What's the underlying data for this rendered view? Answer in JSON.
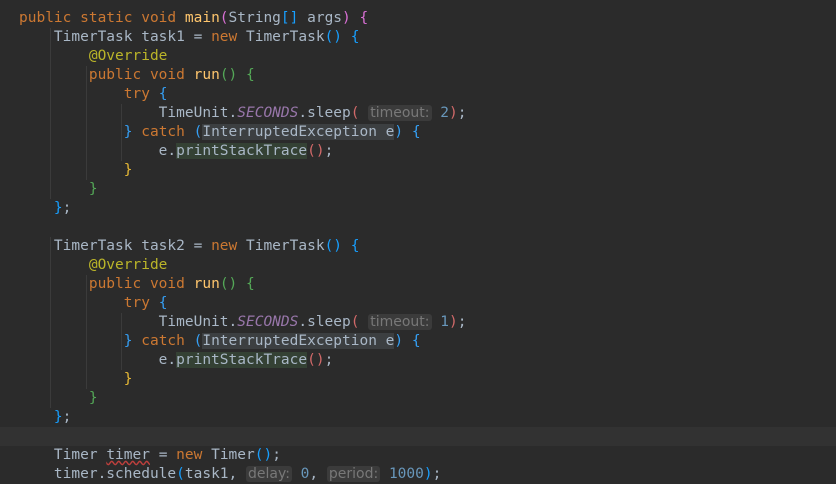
{
  "editor": {
    "language": "Java",
    "theme": "Darcula",
    "lines": [
      {
        "tokens": [
          [
            "kw",
            "public static void "
          ],
          [
            "fn",
            "main"
          ],
          [
            "p2",
            "("
          ],
          [
            "",
            "String"
          ],
          [
            "p3",
            "[]"
          ],
          [
            "",
            " args"
          ],
          [
            "p2",
            ")"
          ],
          [
            "",
            " "
          ],
          [
            "p2",
            "{"
          ]
        ]
      },
      {
        "tokens": [
          [
            "",
            "    TimerTask task1 = "
          ],
          [
            "kw",
            "new "
          ],
          [
            "",
            "TimerTask"
          ],
          [
            "p3",
            "()"
          ],
          [
            "",
            " "
          ],
          [
            "p3",
            "{"
          ]
        ]
      },
      {
        "tokens": [
          [
            "ann",
            "        @Override"
          ]
        ]
      },
      {
        "tokens": [
          [
            "kw",
            "        public void "
          ],
          [
            "fn",
            "run"
          ],
          [
            "p4",
            "()"
          ],
          [
            "",
            " "
          ],
          [
            "p4",
            "{"
          ]
        ]
      },
      {
        "tokens": [
          [
            "kw",
            "            try "
          ],
          [
            "p5",
            "{"
          ]
        ]
      },
      {
        "tokens": [
          [
            "",
            "                TimeUnit."
          ],
          [
            "static-field",
            "SECONDS"
          ],
          [
            "",
            ".sleep"
          ],
          [
            "p6",
            "("
          ],
          [
            "",
            " "
          ],
          [
            "hint",
            "timeout:"
          ],
          [
            "",
            " "
          ],
          [
            "num",
            "2"
          ],
          [
            "p6",
            ")"
          ],
          [
            "",
            ";"
          ]
        ]
      },
      {
        "tokens": [
          [
            "p5",
            "            }"
          ],
          [
            "kw",
            " catch "
          ],
          [
            "p5",
            "("
          ],
          [
            "hl",
            "InterruptedException e"
          ],
          [
            "p5",
            ")"
          ],
          [
            "",
            " "
          ],
          [
            "p5",
            "{"
          ]
        ]
      },
      {
        "tokens": [
          [
            "",
            "                e."
          ],
          [
            "hlw",
            "printStackTrace"
          ],
          [
            "p6",
            "()"
          ],
          [
            "",
            ";"
          ]
        ]
      },
      {
        "tokens": [
          [
            "p1",
            "            }"
          ]
        ]
      },
      {
        "tokens": [
          [
            "p4",
            "        }"
          ]
        ]
      },
      {
        "tokens": [
          [
            "p3",
            "    }"
          ],
          [
            "",
            ";"
          ]
        ]
      },
      {
        "tokens": []
      },
      {
        "tokens": [
          [
            "",
            "    TimerTask task2 = "
          ],
          [
            "kw",
            "new "
          ],
          [
            "",
            "TimerTask"
          ],
          [
            "p3",
            "()"
          ],
          [
            "",
            " "
          ],
          [
            "p3",
            "{"
          ]
        ]
      },
      {
        "tokens": [
          [
            "ann",
            "        @Override"
          ]
        ]
      },
      {
        "tokens": [
          [
            "kw",
            "        public void "
          ],
          [
            "fn",
            "run"
          ],
          [
            "p4",
            "()"
          ],
          [
            "",
            " "
          ],
          [
            "p4",
            "{"
          ]
        ]
      },
      {
        "tokens": [
          [
            "kw",
            "            try "
          ],
          [
            "p5",
            "{"
          ]
        ]
      },
      {
        "tokens": [
          [
            "",
            "                TimeUnit."
          ],
          [
            "static-field",
            "SECONDS"
          ],
          [
            "",
            ".sleep"
          ],
          [
            "p6",
            "("
          ],
          [
            "",
            " "
          ],
          [
            "hint",
            "timeout:"
          ],
          [
            "",
            " "
          ],
          [
            "num",
            "1"
          ],
          [
            "p6",
            ")"
          ],
          [
            "",
            ";"
          ]
        ]
      },
      {
        "tokens": [
          [
            "p5",
            "            }"
          ],
          [
            "kw",
            " catch "
          ],
          [
            "p5",
            "("
          ],
          [
            "hl",
            "InterruptedException e"
          ],
          [
            "p5",
            ")"
          ],
          [
            "",
            " "
          ],
          [
            "p5",
            "{"
          ]
        ]
      },
      {
        "tokens": [
          [
            "",
            "                e."
          ],
          [
            "hlw",
            "printStackTrace"
          ],
          [
            "p6",
            "()"
          ],
          [
            "",
            ";"
          ]
        ]
      },
      {
        "tokens": [
          [
            "p1",
            "            }"
          ]
        ]
      },
      {
        "tokens": [
          [
            "p4",
            "        }"
          ]
        ]
      },
      {
        "tokens": [
          [
            "p3",
            "    }"
          ],
          [
            "",
            ";"
          ]
        ]
      },
      {
        "tokens": [],
        "current": true
      },
      {
        "tokens": [
          [
            "",
            "    Timer "
          ],
          [
            "squiggle",
            "timer"
          ],
          [
            "",
            " = "
          ],
          [
            "kw",
            "new "
          ],
          [
            "",
            "Timer"
          ],
          [
            "p3",
            "()"
          ],
          [
            "",
            ";"
          ]
        ]
      },
      {
        "tokens": [
          [
            "",
            "    timer.schedule"
          ],
          [
            "p3",
            "("
          ],
          [
            "",
            "task1, "
          ],
          [
            "hint",
            "delay:"
          ],
          [
            "",
            " "
          ],
          [
            "num",
            "0"
          ],
          [
            "",
            ", "
          ],
          [
            "hint",
            "period:"
          ],
          [
            "",
            " "
          ],
          [
            "num",
            "1000"
          ],
          [
            "p3",
            ")"
          ],
          [
            "",
            ";"
          ]
        ]
      }
    ]
  },
  "colors": {
    "background": "#2b2b2b",
    "current_line": "#323232",
    "keyword": "#cc7832",
    "method": "#ffc66d",
    "annotation": "#bbb529",
    "number": "#6897bb",
    "static_field": "#9876aa"
  }
}
